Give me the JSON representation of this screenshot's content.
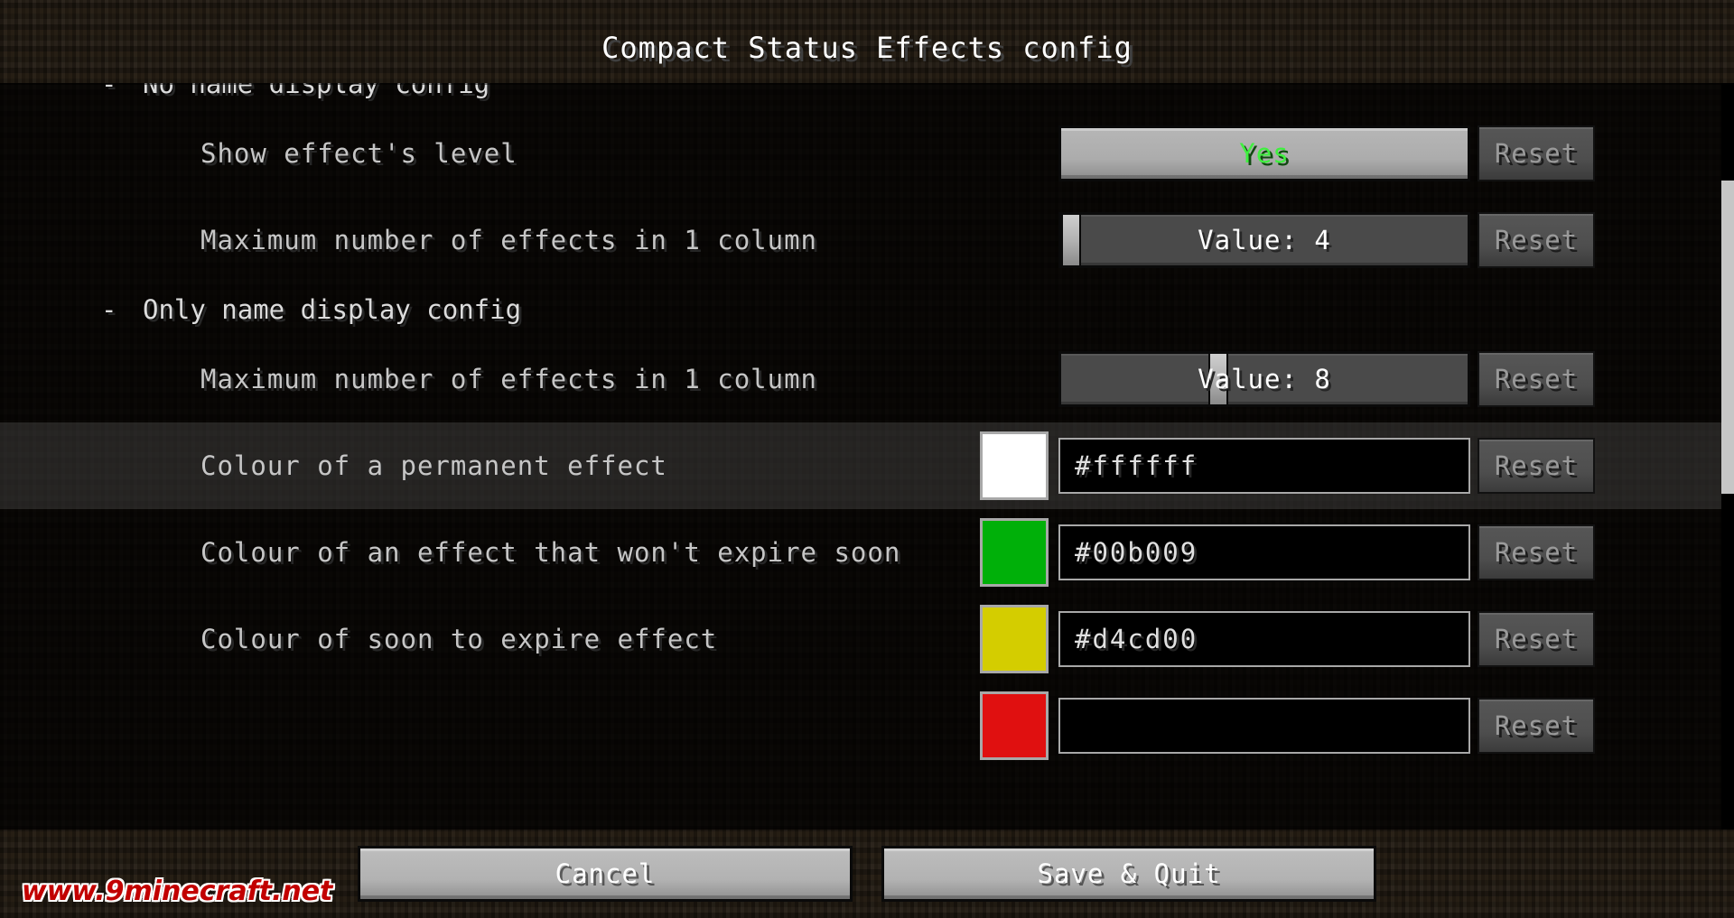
{
  "window": {
    "title": "Compact Status Effects config"
  },
  "list": {
    "rows": [
      {
        "kind": "category",
        "dash": "-",
        "label": "No name display config"
      },
      {
        "kind": "toggle",
        "label": "Show effect's level",
        "value": "Yes",
        "value_color": "#3ff03f",
        "reset_label": "Reset"
      },
      {
        "kind": "slider",
        "label": "Maximum number of effects in 1 column",
        "value": "Value: 4",
        "handle_percent": 0,
        "reset_label": "Reset"
      },
      {
        "kind": "category",
        "dash": "-",
        "label": "Only name display config"
      },
      {
        "kind": "slider",
        "label": "Maximum number of effects in 1 column",
        "value": "Value: 8",
        "handle_percent": 38,
        "reset_label": "Reset"
      },
      {
        "kind": "colour",
        "label": "Colour of a permanent effect",
        "value": "#ffffff",
        "swatch": "#ffffff",
        "reset_label": "Reset",
        "highlighted": true
      },
      {
        "kind": "colour",
        "label": "Colour of an effect that won't expire soon",
        "value": "#00b009",
        "swatch": "#00b009",
        "reset_label": "Reset",
        "highlighted": false
      },
      {
        "kind": "colour",
        "label": "Colour of soon to expire effect",
        "value": "#d4cd00",
        "swatch": "#d4cd00",
        "reset_label": "Reset",
        "highlighted": false
      },
      {
        "kind": "colour",
        "label": "",
        "value": "",
        "swatch": "#e01010",
        "reset_label": "Reset",
        "highlighted": false
      }
    ]
  },
  "scrollbar": {
    "thumb_top_percent": 13,
    "thumb_height_percent": 42
  },
  "footer": {
    "cancel_label": "Cancel",
    "save_quit_label": "Save & Quit"
  },
  "watermark": {
    "text": "www.9minecraft.net"
  },
  "theme": {
    "accent_green": "#3ff03f",
    "background_dirt": "#3a2d1e",
    "panel_overlay": "rgba(0,0,0,0.74)",
    "button_light": "#b6b6b6",
    "text_primary": "#ffffff",
    "text_secondary": "#c6c6c6",
    "reset_text": "#9a9a9a"
  }
}
